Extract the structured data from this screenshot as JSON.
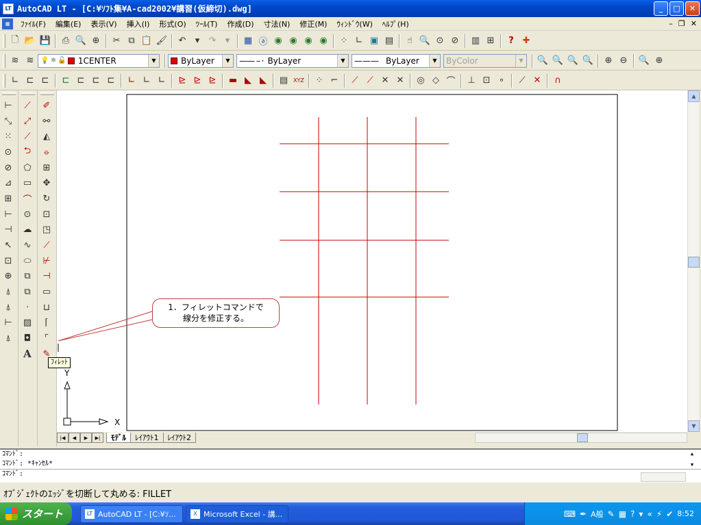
{
  "window": {
    "title": "AutoCAD LT - [C:¥ｿﾌﾄ集¥A-cad2002¥講習(仮締切).dwg]",
    "app_icon": "LT"
  },
  "menu": [
    "ﾌｧｲﾙ(F)",
    "編集(E)",
    "表示(V)",
    "挿入(I)",
    "形式(O)",
    "ﾂｰﾙ(T)",
    "作成(D)",
    "寸法(N)",
    "修正(M)",
    "ｳｨﾝﾄﾞｳ(W)",
    "ﾍﾙﾌﾟ(H)"
  ],
  "properties": {
    "layer": "1CENTER",
    "color": "ByLayer",
    "linetype": "ByLayer",
    "lineweight": "ByLayer",
    "plotstyle": "ByColor",
    "color_swatch": "#e00000"
  },
  "callout": {
    "line1": "1．フィレットコマンドで",
    "line2": "線分を修正する。"
  },
  "tooltip": "ﾌｨﾚｯﾄ",
  "ucs": {
    "x": "X",
    "y": "Y"
  },
  "tabs": [
    "ﾓﾃﾞﾙ",
    "ﾚｲｱｳﾄ1",
    "ﾚｲｱｳﾄ2"
  ],
  "command": {
    "line1": "ｺﾏﾝﾄﾞ:",
    "line2": "ｺﾏﾝﾄﾞ: *ｷｬﾝｾﾙ*",
    "line3": "ｺﾏﾝﾄﾞ:"
  },
  "status_text": "ｵﾌﾞｼﾞｪｸﾄのｴｯｼﾞを切断して丸める: FILLET",
  "taskbar": {
    "start": "スタート",
    "items": [
      "AutoCAD LT - [C:¥ｿ...",
      "Microsoft Excel - 講..."
    ],
    "clock": "8:52",
    "ime": "A般"
  },
  "colors": {
    "grid": "#cc0000"
  }
}
